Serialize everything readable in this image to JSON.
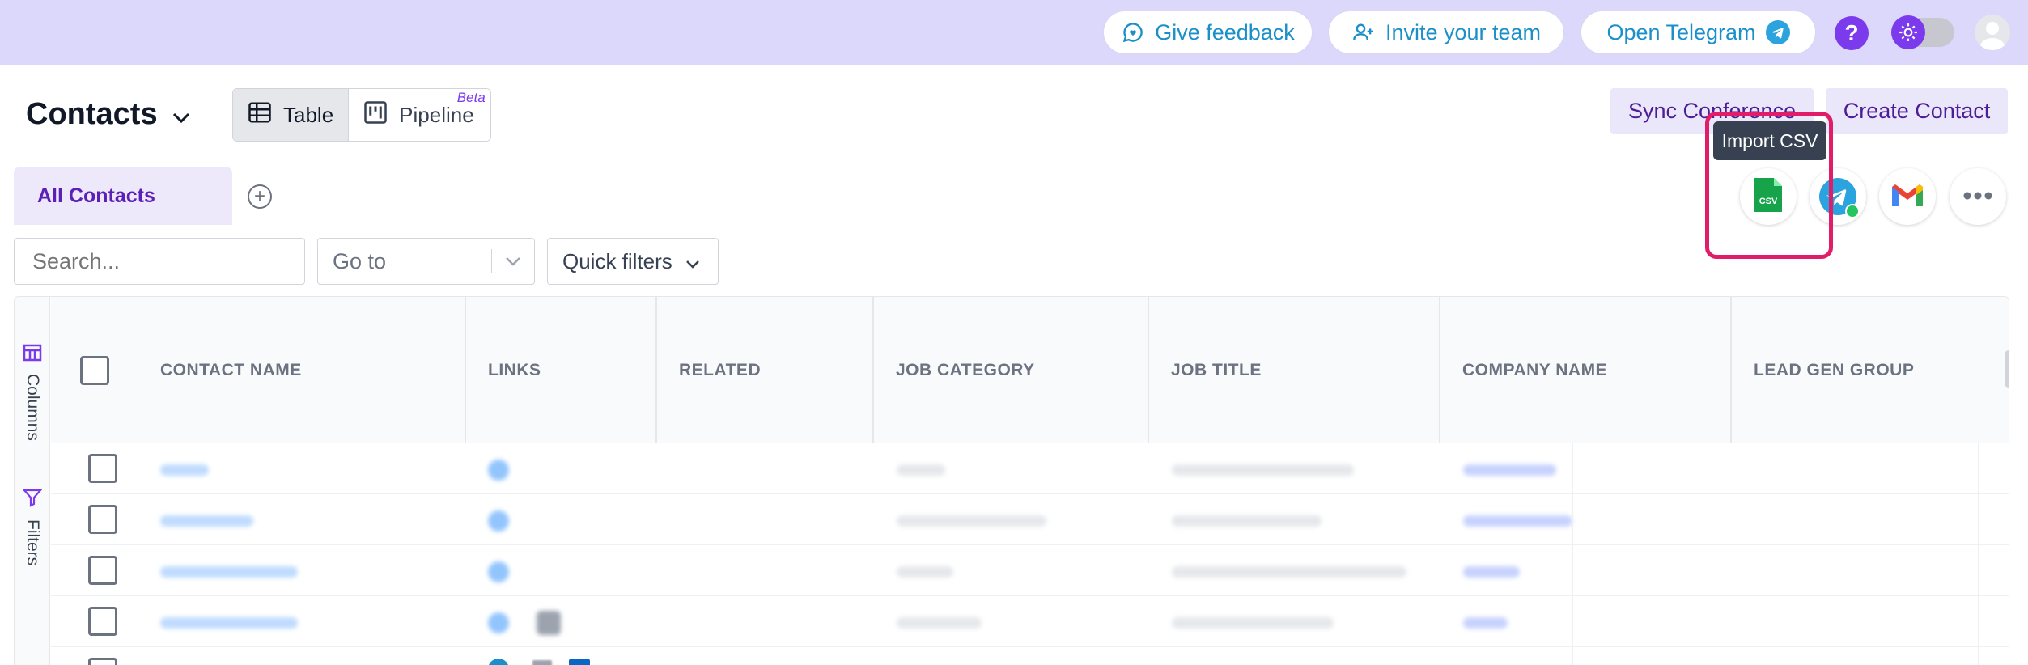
{
  "topbar": {
    "feedback_label": "Give feedback",
    "invite_label": "Invite your team",
    "telegram_label": "Open Telegram",
    "help_label": "?"
  },
  "header": {
    "title": "Contacts",
    "view_table": "Table",
    "view_pipeline": "Pipeline",
    "beta_badge": "Beta",
    "sync_label": "Sync Conference",
    "create_label": "Create Contact"
  },
  "tabs": {
    "all_contacts": "All Contacts",
    "add": "+"
  },
  "integrations": {
    "tooltip": "Import CSV",
    "csv_text": "CSV"
  },
  "filters": {
    "search_placeholder": "Search...",
    "goto_label": "Go to",
    "quick_label": "Quick filters"
  },
  "table": {
    "sidebar_columns": "Columns",
    "sidebar_filters": "Filters",
    "columns": [
      "CONTACT NAME",
      "LINKS",
      "RELATED",
      "JOB CATEGORY",
      "JOB TITLE",
      "COMPANY NAME",
      "LEAD GEN GROUP"
    ],
    "add_column": "+"
  },
  "colors": {
    "topbar_bg": "#dcd8fb",
    "accent": "#7c3aed",
    "link_blue": "#1a8fc9",
    "highlight": "#e11d6a"
  }
}
